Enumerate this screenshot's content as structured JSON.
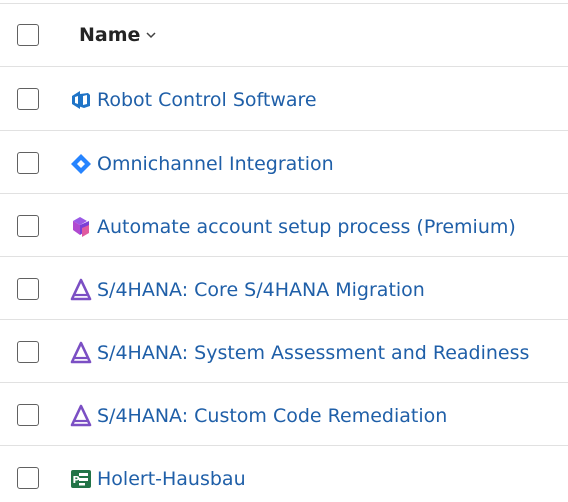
{
  "header": {
    "name_label": "Name",
    "sort_icon": "chevron-down-icon"
  },
  "rows": [
    {
      "label": "Robot Control Software",
      "icon": "azure-devops-icon",
      "icon_color": "#1f74c7"
    },
    {
      "label": "Omnichannel Integration",
      "icon": "jira-diamond-icon",
      "icon_color": "#2684ff"
    },
    {
      "label": "Automate account setup process (Premium)",
      "icon": "planner-premium-icon",
      "icon_color": "#8a42d8"
    },
    {
      "label": "S/4HANA: Core S/4HANA Migration",
      "icon": "sap-cloud-alm-icon",
      "icon_color": "#7b4fc4"
    },
    {
      "label": "S/4HANA: System Assessment and Readiness",
      "icon": "sap-cloud-alm-icon",
      "icon_color": "#7b4fc4"
    },
    {
      "label": "S/4HANA: Custom Code Remediation",
      "icon": "sap-cloud-alm-icon",
      "icon_color": "#7b4fc4"
    },
    {
      "label": "Holert-Hausbau",
      "icon": "project-icon",
      "icon_color": "#217346"
    }
  ],
  "colors": {
    "link": "#1f5fa8",
    "divider": "#e1e1e1"
  }
}
